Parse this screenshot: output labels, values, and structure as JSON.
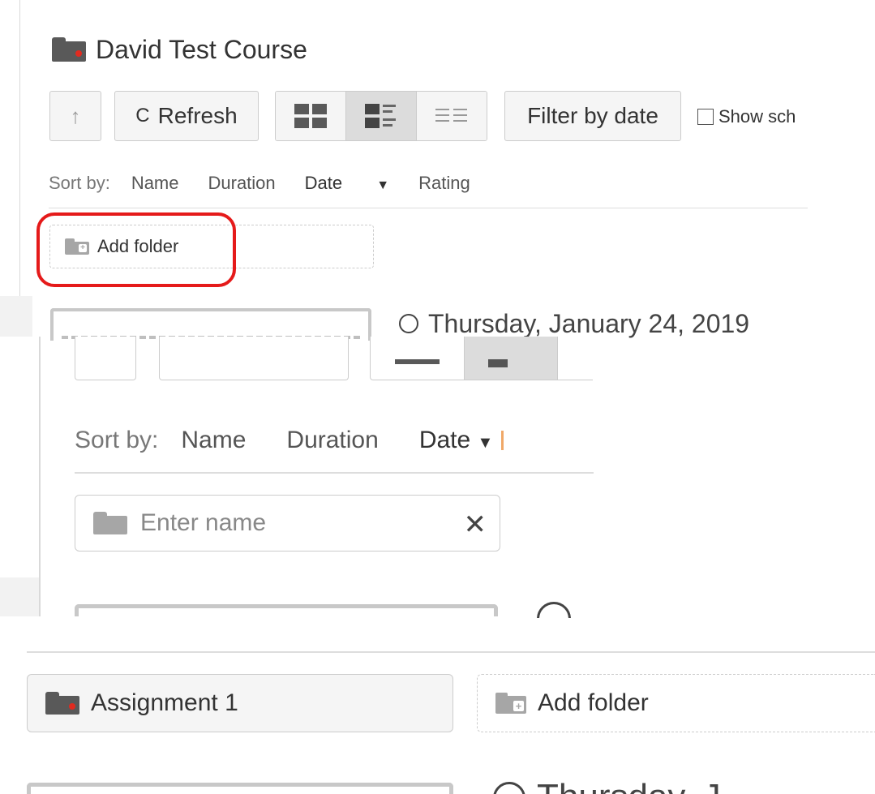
{
  "panel1": {
    "course_title": "David Test Course",
    "toolbar": {
      "up_glyph": "↑",
      "refresh_glyph": "C",
      "refresh_label": "Refresh",
      "filter_label": "Filter by date",
      "show_label": "Show sch"
    },
    "sort": {
      "label": "Sort by:",
      "options": [
        "Name",
        "Duration",
        "Date",
        "Rating"
      ],
      "active": "Date",
      "active_indicator": "▼"
    },
    "add_folder_label": "Add folder",
    "session_date": "Thursday, January 24, 2019"
  },
  "panel2": {
    "sort": {
      "label": "Sort by:",
      "options": [
        "Name",
        "Duration",
        "Date"
      ],
      "active_indicator": "▼"
    },
    "new_folder_input": {
      "placeholder": "Enter name",
      "clear_glyph": "✕"
    }
  },
  "panel3": {
    "folder_name": "Assignment 1",
    "add_folder_label": "Add folder",
    "next_text": "Thursday, J"
  },
  "colors": {
    "highlight_circle": "#e51a1a",
    "folder_dot": "#e02b20",
    "folder_dark": "#595959",
    "folder_gray": "#a6a6a6",
    "orange_marker": "#f0a868"
  },
  "icons": [
    "folder-icon",
    "arrow-up-icon",
    "refresh-icon",
    "thumbnail-grid-icon",
    "detail-list-icon",
    "compact-list-icon",
    "checkbox-icon",
    "caret-down-icon",
    "add-folder-icon",
    "radio-icon",
    "close-icon"
  ]
}
